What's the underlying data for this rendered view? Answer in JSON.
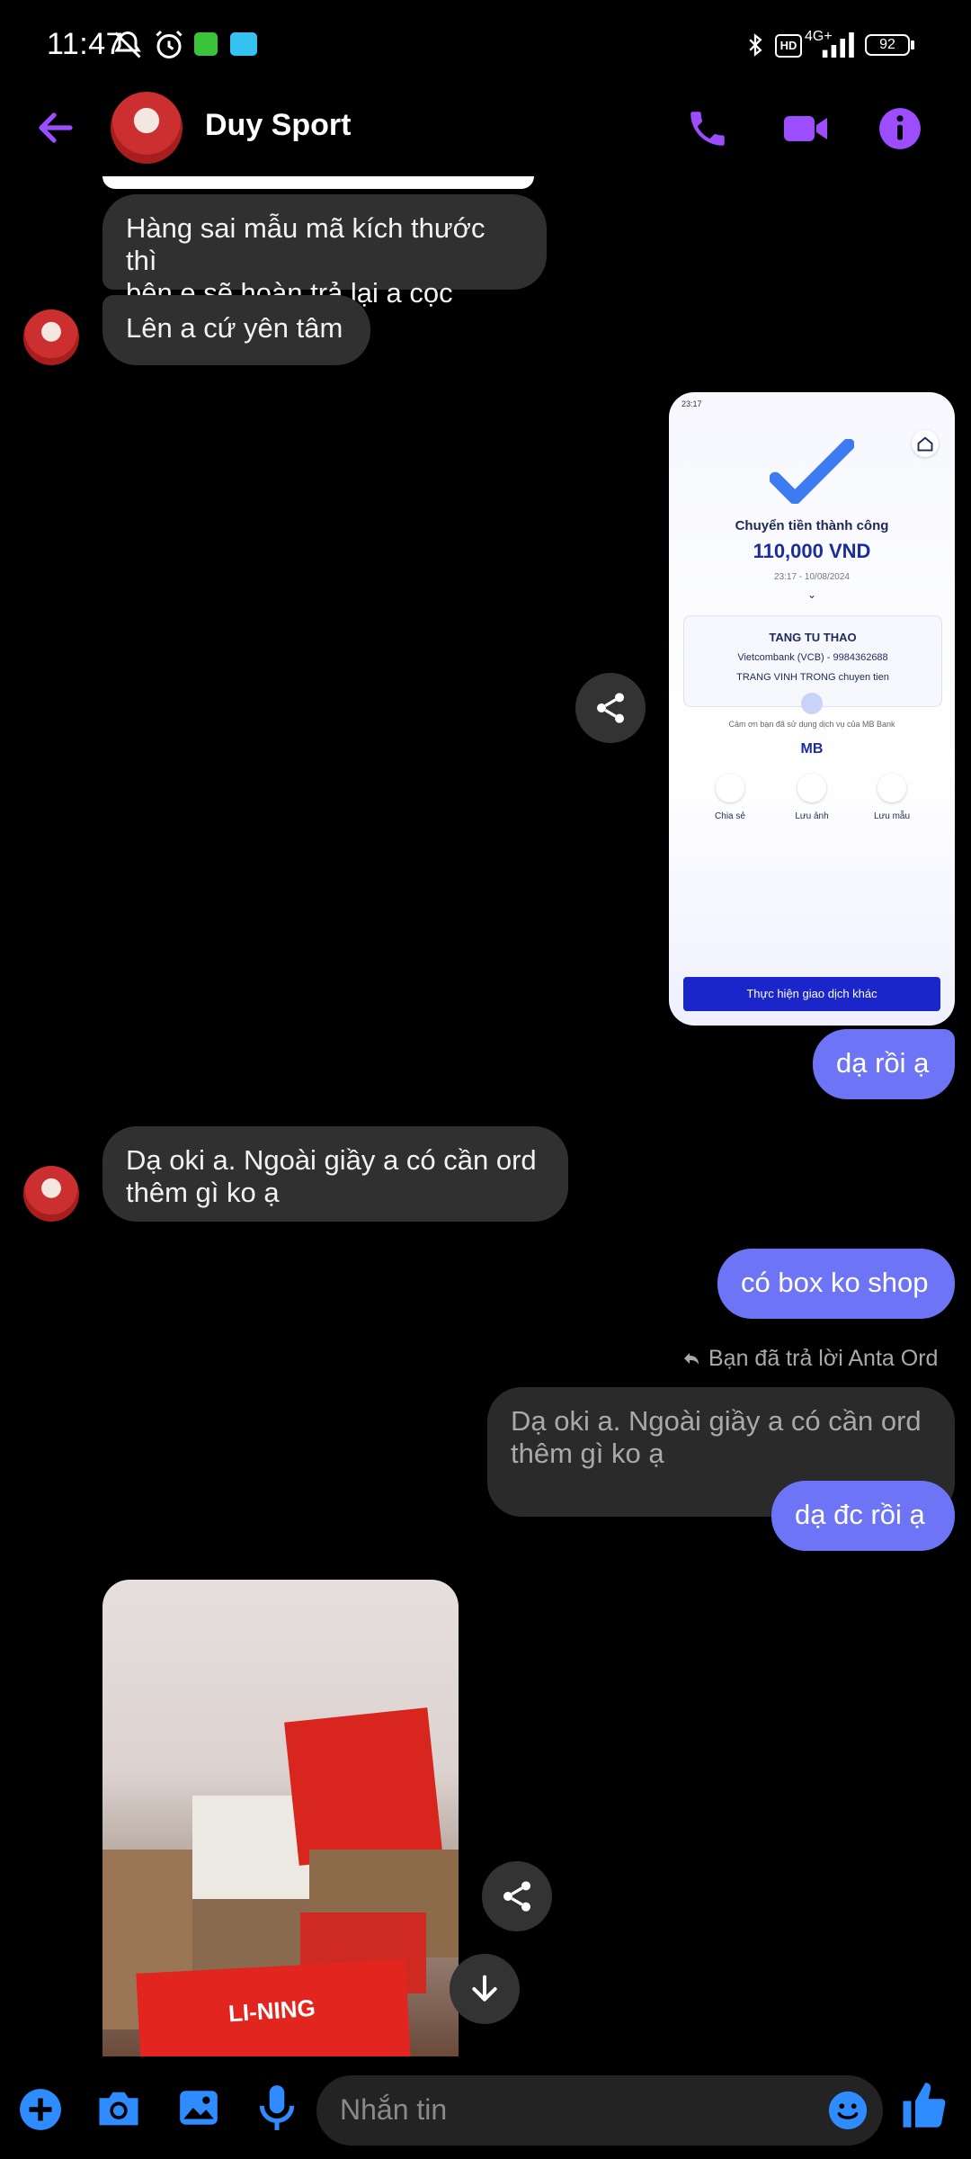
{
  "status_bar": {
    "time": "11:47",
    "network": "4G+",
    "hd": "HD",
    "battery": "92"
  },
  "header": {
    "contact_name": "Duy Sport",
    "icons": [
      "back-arrow-icon",
      "phone-icon",
      "video-icon",
      "info-icon"
    ]
  },
  "messages": [
    {
      "side": "in",
      "text_1": "Hàng sai mẫu mã kích thước thì",
      "text_2": "bên e sẽ hoàn trả lại a cọc"
    },
    {
      "side": "in",
      "text": "Lên a cứ yên tâm"
    },
    {
      "side": "out",
      "text": "dạ rồi ạ"
    },
    {
      "side": "in",
      "text_1": "Dạ oki a. Ngoài giầy a có cần ord",
      "text_2": "thêm gì ko ạ"
    },
    {
      "side": "out",
      "text": "có box ko shop"
    },
    {
      "side": "out",
      "reply_label": "Bạn đã trả lời Anta Ord",
      "quoted_1": "Dạ oki a. Ngoài giầy a có cần ord",
      "quoted_2": "thêm gì ko ạ",
      "text": "dạ đc rồi ạ"
    }
  ],
  "receipt": {
    "time_status": "23:17",
    "title": "Chuyển tiền thành công",
    "amount": "110,000 VND",
    "datetime": "23:17 - 10/08/2024",
    "recipient": "TANG TU THAO",
    "bank": "Vietcombank (VCB) - 9984362688",
    "memo": "TRANG VINH TRONG chuyen tien",
    "thanks": "Cảm ơn bạn đã sử dụng dịch vụ của MB Bank",
    "brand": "MB",
    "actions": [
      "Chia sẻ",
      "Lưu ảnh",
      "Lưu mẫu"
    ],
    "button": "Thực hiện giao dịch khác"
  },
  "photo": {
    "brand_text": "LI-NING"
  },
  "composer": {
    "placeholder": "Nhắn tin"
  },
  "colors": {
    "accent": "#9b4dff",
    "out_bubble": "#6e74f6",
    "in_bubble": "#303030",
    "composer_icon": "#2f8cff"
  }
}
